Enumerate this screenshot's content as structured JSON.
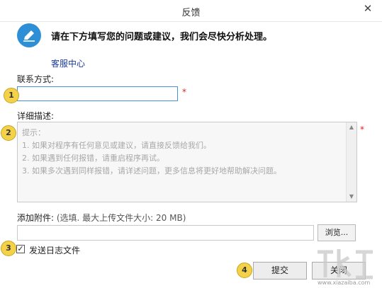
{
  "window": {
    "title": "反馈",
    "close_icon": "close-icon"
  },
  "header": {
    "icon": "edit-pencil-icon",
    "text": "请在下方填写您的问题或建议，我们会尽快分析处理。",
    "service_link": "客服中心"
  },
  "contact": {
    "label": "联系方式:",
    "value": "",
    "required_mark": "*"
  },
  "description": {
    "label": "详细描述:",
    "required_mark": "*",
    "placeholder_lines": [
      "提示：",
      "1. 如果对程序有任何意见或建议，请直接反馈给我们。",
      "2. 如果遇到任何报错，请重启程序再试。",
      "3. 如果多次遇到同样报错，请详述问题，更多信息将更好地帮助解决问题。"
    ]
  },
  "attachment": {
    "label": "添加附件:",
    "hint": "(选填. 最大上传文件大小: 20 MB)",
    "value": "",
    "browse_label": "浏览..."
  },
  "send_log": {
    "label": "发送日志文件",
    "checked": true
  },
  "buttons": {
    "submit": "提交",
    "close": "关闭"
  },
  "markers": [
    "1",
    "2",
    "3",
    "4"
  ],
  "watermark": {
    "url": "www.xiazaiba.com"
  },
  "colors": {
    "accent": "#2e8fd6",
    "link": "#1a3a9e",
    "required": "#e02020",
    "marker": "#f3d24a"
  }
}
